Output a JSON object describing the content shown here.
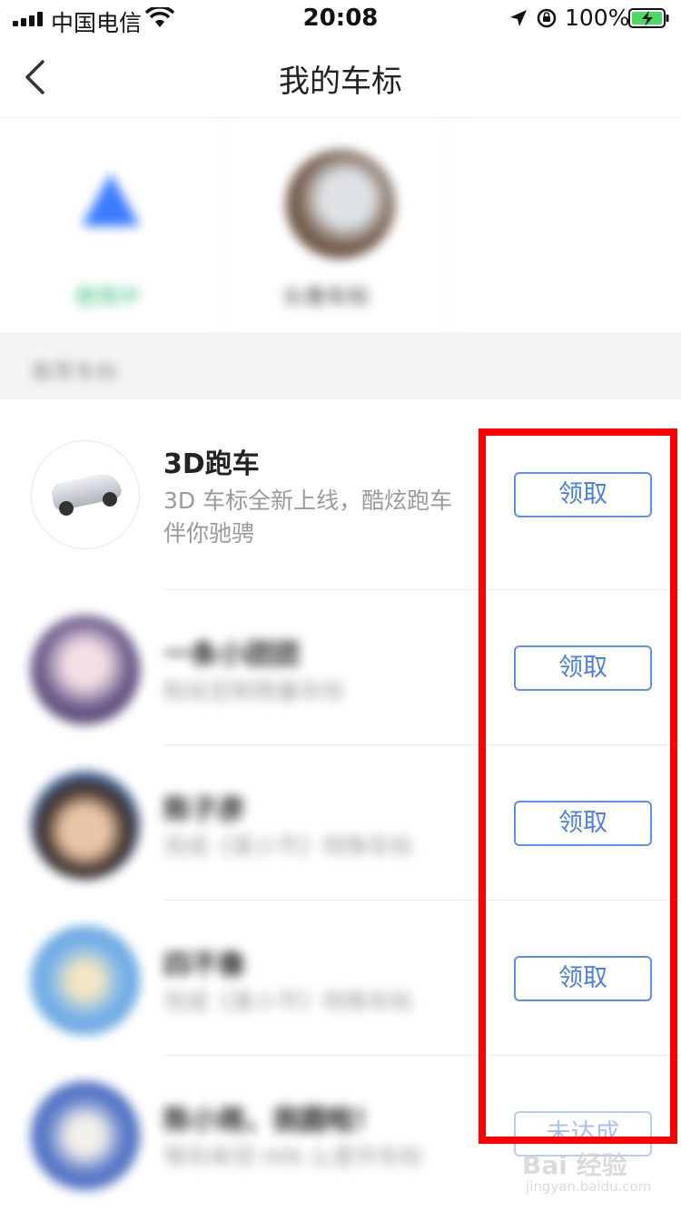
{
  "status_bar": {
    "carrier": "中国电信",
    "time": "20:08",
    "battery": "100%"
  },
  "nav": {
    "title": "我的车标"
  },
  "current_badges": [
    {
      "caption": "使用中"
    },
    {
      "caption": "头像车标"
    },
    {
      "caption": ""
    }
  ],
  "section": {
    "title": "推荐车标"
  },
  "list": [
    {
      "title": "3D跑车",
      "desc_line1": "3D 车标全新上线，酷炫跑车",
      "desc_line2": "伴你驰骋",
      "button": "领取"
    },
    {
      "title": "一条小团团",
      "desc": "粉丝定制限量车标",
      "button": "领取"
    },
    {
      "title": "陈子彦",
      "desc": "完成《某小节》特殊车标",
      "button": "领取"
    },
    {
      "title": "四不像",
      "desc": "完成《某小节》特殊车标",
      "button": "领取"
    },
    {
      "title": "陈小雨，我圆啦！",
      "desc": "等你来领 HIN 么爱作车标",
      "button": "未达成"
    }
  ],
  "watermark": {
    "main": "Bai 经验",
    "sub": "jingyan.baidu.com"
  },
  "colors": {
    "accent": "#4a7fe6",
    "highlight": "#ff0000",
    "battery": "#4cd964"
  }
}
